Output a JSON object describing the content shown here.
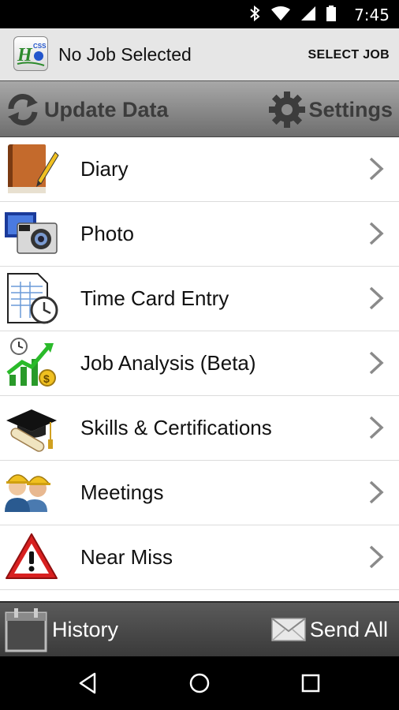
{
  "status_bar": {
    "time": "7:45",
    "icons": [
      "bluetooth-icon",
      "wifi-icon",
      "signal-icon",
      "battery-icon"
    ]
  },
  "header": {
    "logo_text": "HCSS",
    "title": "No Job Selected",
    "select_job": "SELECT JOB"
  },
  "toolbar": {
    "update": "Update Data",
    "settings": "Settings"
  },
  "menu": [
    {
      "label": "Diary",
      "icon": "diary-icon"
    },
    {
      "label": "Photo",
      "icon": "camera-icon"
    },
    {
      "label": "Time Card Entry",
      "icon": "timecard-icon"
    },
    {
      "label": "Job Analysis (Beta)",
      "icon": "job-analysis-icon"
    },
    {
      "label": "Skills & Certifications",
      "icon": "graduation-cap-icon"
    },
    {
      "label": "Meetings",
      "icon": "meeting-people-icon"
    },
    {
      "label": "Near Miss",
      "icon": "warning-icon"
    }
  ],
  "footer": {
    "history": "History",
    "send_all": "Send All"
  },
  "nav": [
    "back-icon",
    "home-icon",
    "recents-icon"
  ],
  "colors": {
    "header_bg": "#e6e6e6",
    "toolbar_text": "#3c3c3c",
    "footer_bg": "#444444",
    "chevron": "#8a8a8a"
  }
}
